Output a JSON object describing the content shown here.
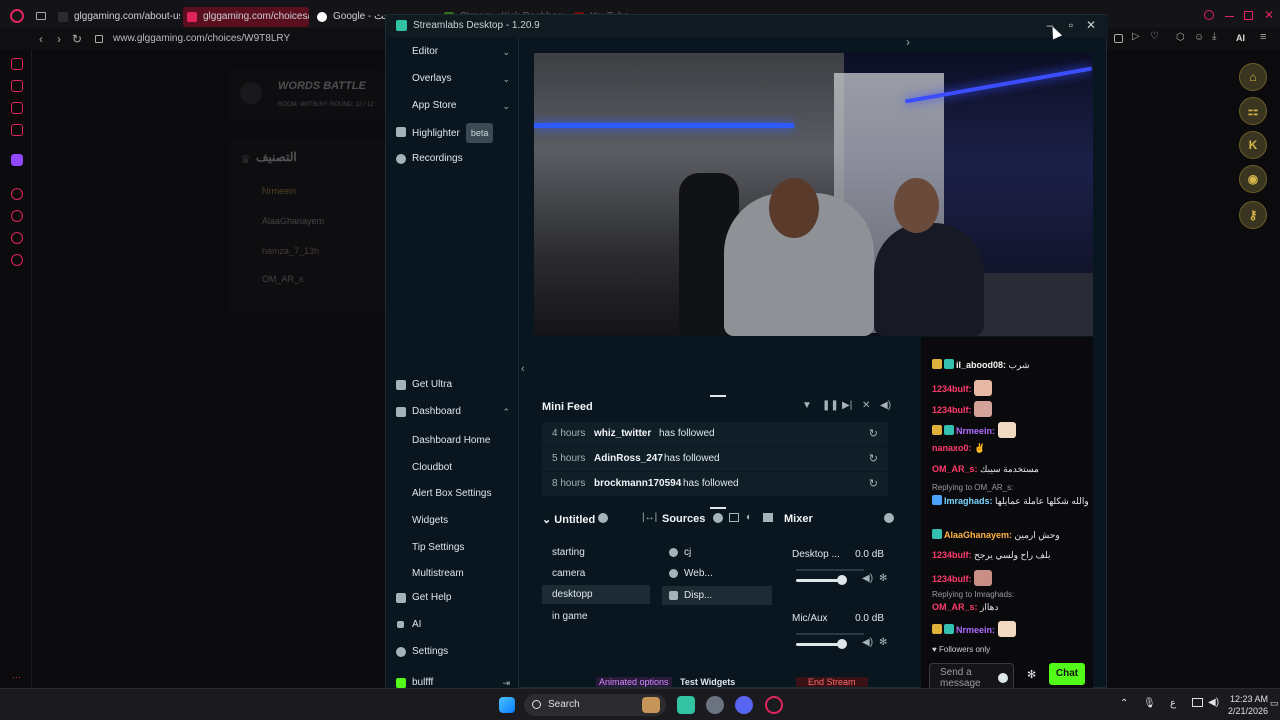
{
  "browser": {
    "tabs": [
      {
        "label": "glggaming.com/about-us",
        "active": false
      },
      {
        "label": "glggaming.com/choices/V",
        "active": true
      },
      {
        "label": "Google - بحث",
        "active": false
      },
      {
        "label": "Stream - Kick Dashboard",
        "active": false
      },
      {
        "label": "YouTube",
        "active": false
      }
    ],
    "url": "www.glggaming.com/choices/W9T8LRY",
    "ai_label": "AI",
    "right_rail": [
      "home-icon",
      "gamepad-icon",
      "K",
      "discord-icon",
      "key-icon"
    ]
  },
  "background_page": {
    "game_title": "WORDS BATTLE",
    "room": "ROOM: W9T8LRY",
    "round": "ROUND: 12 / 12",
    "ranking_title": "التصنيف",
    "players": [
      "Nrmeein",
      "AlaaGhanayem",
      "hamza_7_13h",
      "OM_AR_s"
    ]
  },
  "streamlabs": {
    "title": "Streamlabs Desktop - 1.20.9",
    "nav": {
      "editor": "Editor",
      "overlays": "Overlays",
      "app_store": "App Store",
      "highlighter": "Highlighter",
      "beta": "beta",
      "recordings": "Recordings",
      "get_ultra": "Get Ultra",
      "dashboard": "Dashboard",
      "dashboard_sub": [
        "Dashboard Home",
        "Cloudbot",
        "Alert Box Settings",
        "Widgets",
        "Tip Settings",
        "Multistream"
      ],
      "get_help": "Get Help",
      "ai": "AI",
      "settings": "Settings",
      "user": "bulfff"
    },
    "mini_feed": {
      "title": "Mini Feed",
      "rows": [
        {
          "time": "4 hours",
          "user": "whiz_twitter",
          "action": "has followed"
        },
        {
          "time": "5 hours",
          "user": "AdinRoss_247",
          "action": "has followed"
        },
        {
          "time": "8 hours",
          "user": "brockmann170594",
          "action": "has followed"
        }
      ]
    },
    "scenes": {
      "title": "Untitled",
      "items": [
        "starting",
        "camera",
        "desktopp",
        "in game"
      ],
      "selected": "desktopp"
    },
    "sources": {
      "title": "Sources",
      "items": [
        "cj",
        "Web...",
        "Disp..."
      ]
    },
    "mixer": {
      "title": "Mixer",
      "channels": [
        {
          "name": "Desktop ...",
          "db": "0.0 dB"
        },
        {
          "name": "Mic/Aux",
          "db": "0.0 dB"
        }
      ]
    },
    "footer": {
      "animated_options": "Animated options",
      "test_widgets": "Test Widgets",
      "end_stream": "End Stream"
    }
  },
  "chat": {
    "messages": [
      {
        "user": "il_abood08:",
        "text": "شرب",
        "color": "#f5f5f5",
        "emote": false
      },
      {
        "user": "1234bulf:",
        "text": "",
        "color": "#ff3b6b",
        "emote": true
      },
      {
        "user": "1234bulf:",
        "text": "",
        "color": "#ff3b6b",
        "emote": true
      },
      {
        "user": "Nrmeein:",
        "text": "",
        "color": "#b06bff",
        "emote": true
      },
      {
        "user": "nanaxo0:",
        "text": "",
        "color": "#ff3b6b",
        "emote": true
      },
      {
        "user": "OM_AR_s:",
        "text": "مستخدمة سيبك",
        "color": "#ff3b6b",
        "emote": false
      },
      {
        "user": "Imraghads:",
        "text": "والله شكلها عاملة عمايلها",
        "color": "#7ad7ff",
        "emote": false
      },
      {
        "user": "AlaaGhanayem:",
        "text": "وحش ارمين",
        "color": "#ffb347",
        "emote": false
      },
      {
        "user": "1234bulf:",
        "text": "بلف راح ولسي يرجح",
        "color": "#ff3b6b",
        "emote": false
      },
      {
        "user": "1234bulf:",
        "text": "",
        "color": "#ff3b6b",
        "emote": true
      },
      {
        "user": "OM_AR_s:",
        "text": "دهااز",
        "color": "#ff3b6b",
        "emote": false
      },
      {
        "user": "Nrmeein:",
        "text": "",
        "color": "#b06bff",
        "emote": true
      }
    ],
    "reply_1": "Replying to OM_AR_s:",
    "reply_2": "Replying to Imraghads:",
    "followers_only": "Followers only",
    "placeholder": "Send a message",
    "send_label": "Chat"
  },
  "taskbar": {
    "search": "Search",
    "time": "12:23 AM",
    "date": "2/21/2026",
    "lang": "ع"
  }
}
